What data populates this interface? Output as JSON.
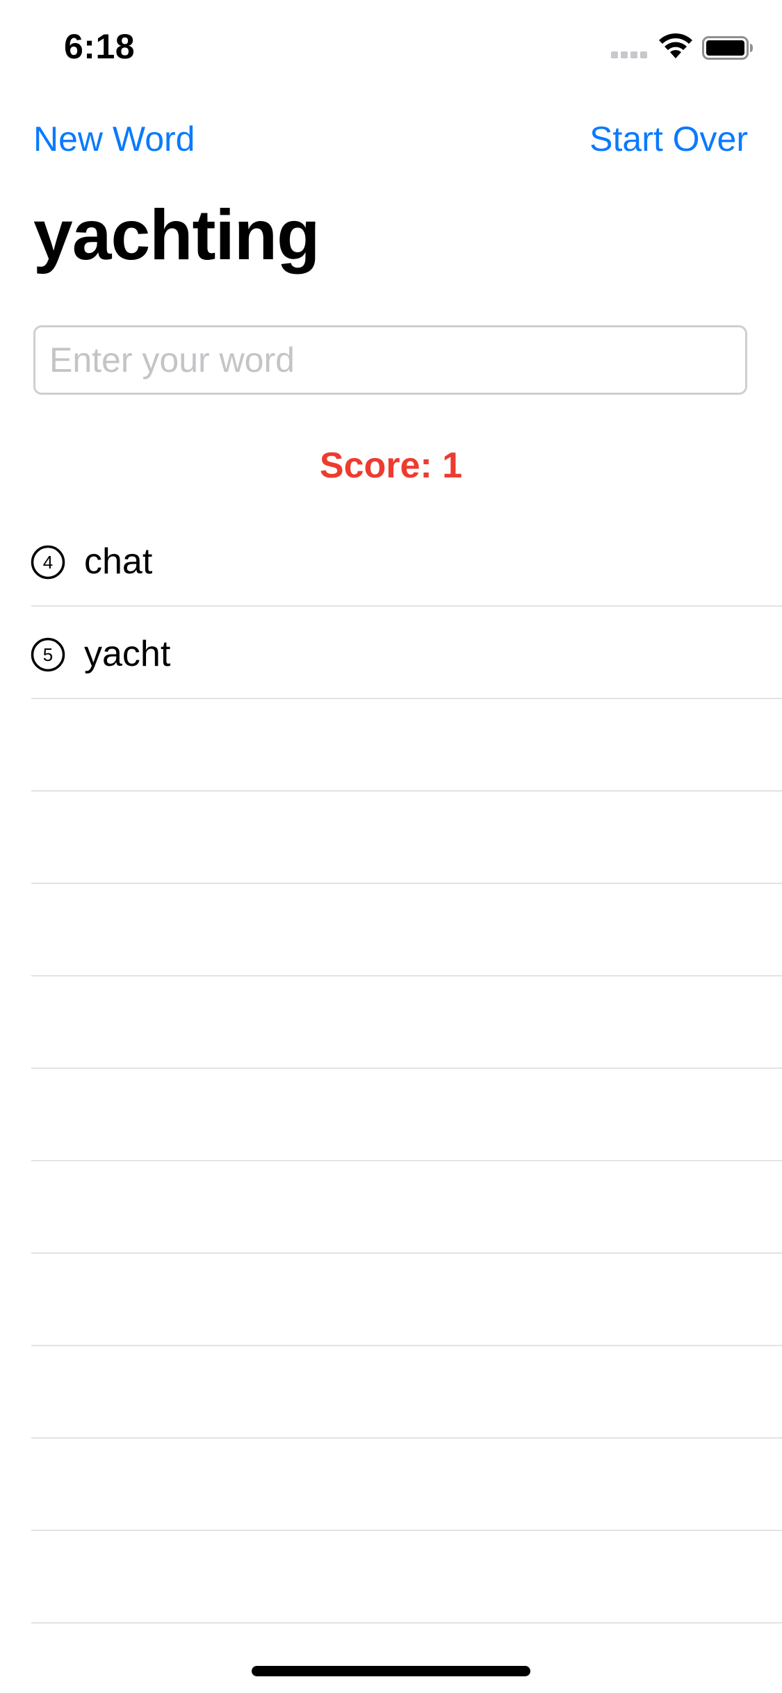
{
  "status_bar": {
    "time": "6:18",
    "icons": [
      "cellular-signal-icon",
      "wifi-icon",
      "battery-icon"
    ]
  },
  "nav": {
    "left_button": "New Word",
    "right_button": "Start Over"
  },
  "title": "yachting",
  "input": {
    "placeholder": "Enter your word",
    "value": ""
  },
  "score_text": "Score: 1",
  "words": [
    {
      "count": "4",
      "word": "chat",
      "icon": "circled-number-icon"
    },
    {
      "count": "5",
      "word": "yacht",
      "icon": "circled-number-icon"
    }
  ],
  "colors": {
    "accent": "#0a7aff",
    "score": "#ee3b30",
    "separator": "#e3e3e6",
    "input_border": "#cfcfd3",
    "placeholder": "#c4c4c7"
  }
}
